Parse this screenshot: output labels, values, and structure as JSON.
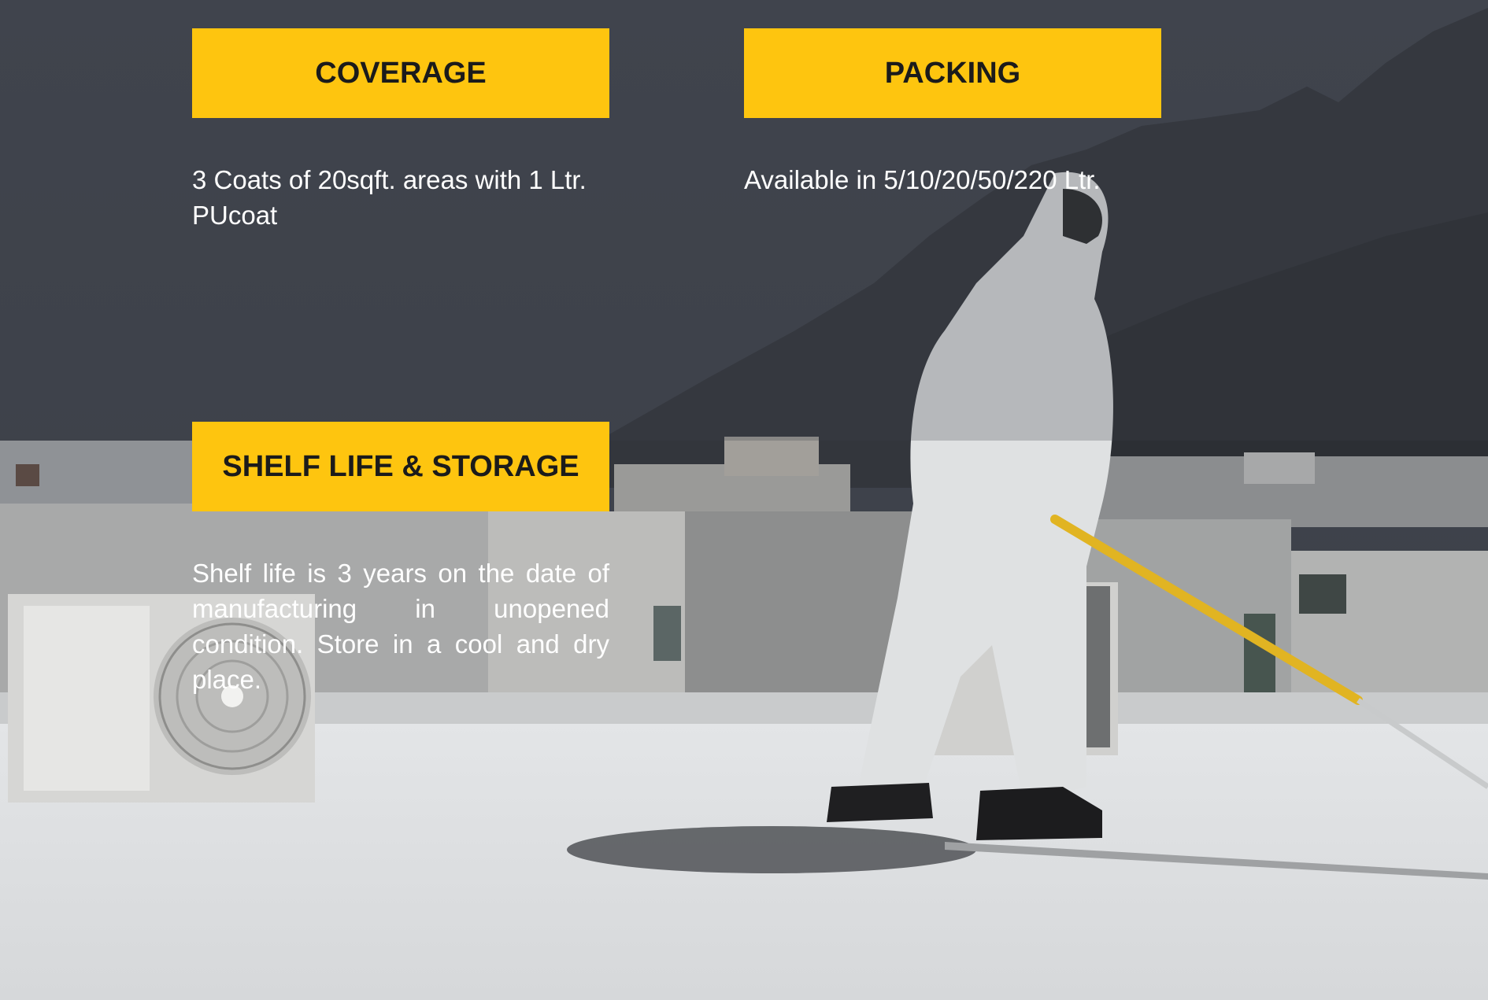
{
  "theme": {
    "accent": "#fec50f",
    "heading_text": "#1b1b1b",
    "body_text": "#ffffff",
    "sky": "#454a55"
  },
  "sections": {
    "coverage": {
      "heading": "COVERAGE",
      "text": "3 Coats of 20sqft. areas with 1 Ltr. PUcoat"
    },
    "packing": {
      "heading": "PACKING",
      "text": "Available in 5/10/20/50/220 Ltr."
    },
    "shelf": {
      "heading": "SHELF LIFE & STORAGE",
      "text": "Shelf life is 3 years on the date of manufacturing in unopened condition.  Store in a cool and dry place."
    }
  }
}
